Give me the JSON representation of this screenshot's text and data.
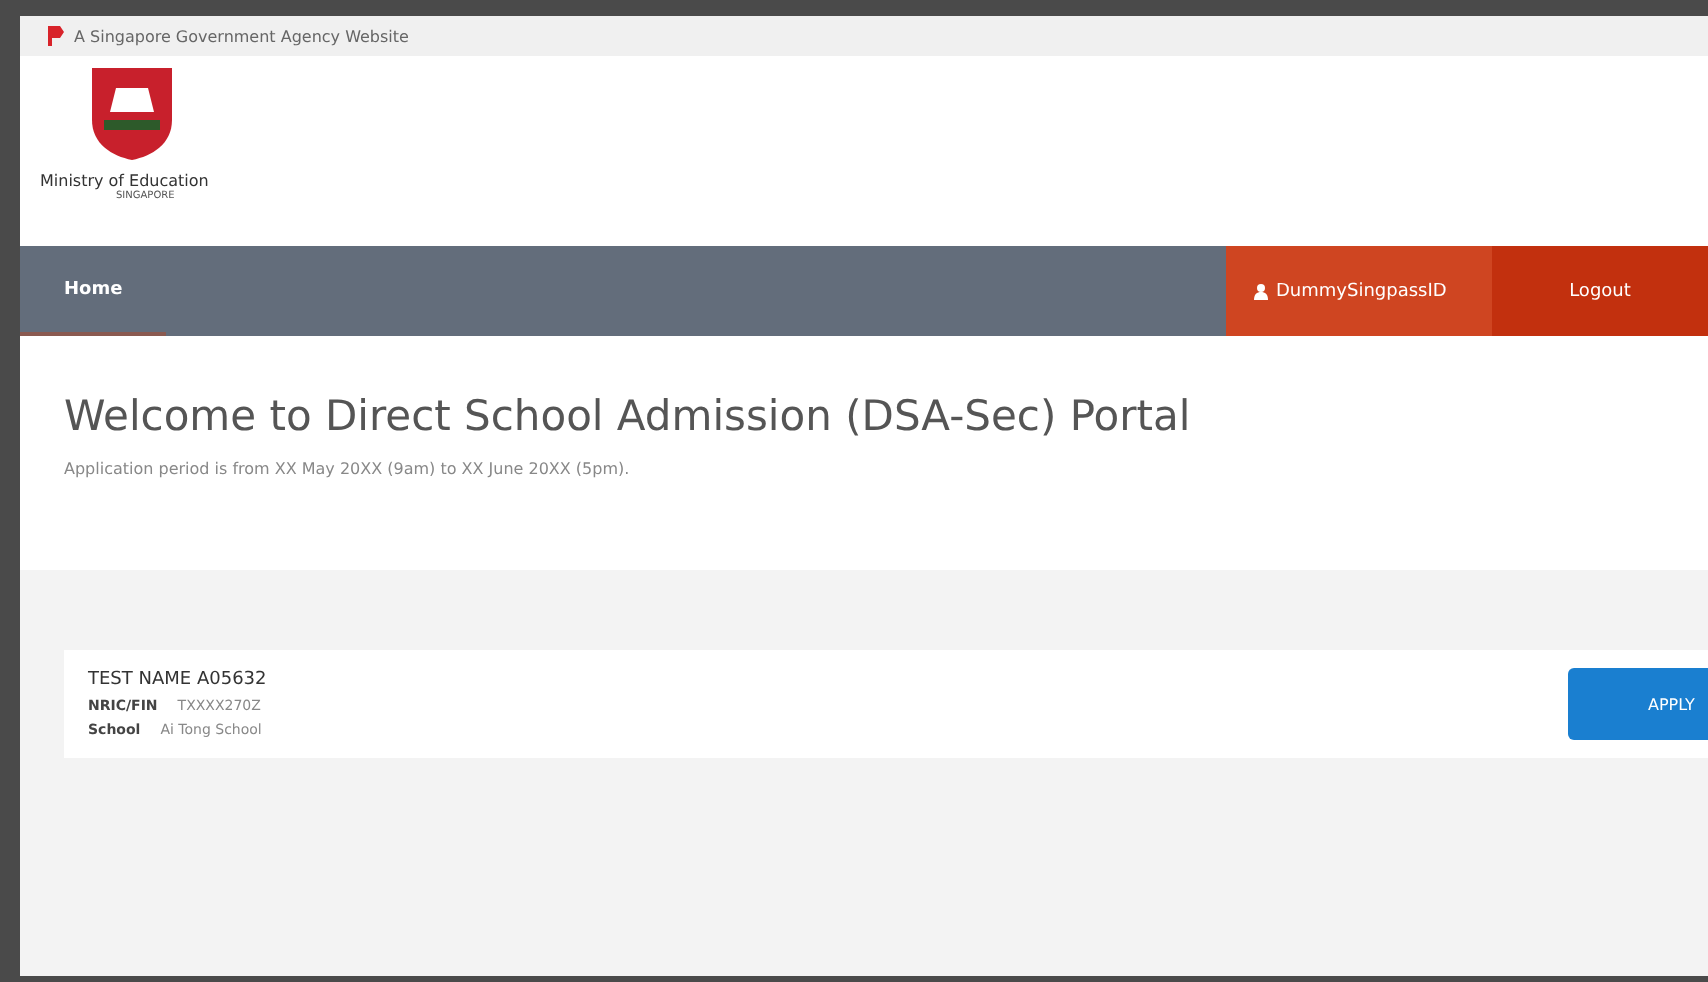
{
  "masthead": {
    "text": "A Singapore Government Agency Website"
  },
  "logo": {
    "name": "Ministry of Education",
    "subtitle": "SINGAPORE"
  },
  "nav": {
    "items": [
      {
        "label": "Home",
        "selected": true
      }
    ],
    "user": "DummySingpassID",
    "logout": "Logout"
  },
  "welcome": {
    "title": "Welcome to Direct School Admission (DSA-Sec) Portal",
    "subtitle": "Application period is from XX May 20XX (9am) to XX June 20XX (5pm)."
  },
  "applicant": {
    "name": "TEST NAME A05632",
    "fields": [
      {
        "label": "NRIC/FIN",
        "value": "TXXXX270Z"
      },
      {
        "label": "School",
        "value": "Ai Tong School"
      }
    ],
    "button": "APPLY"
  }
}
